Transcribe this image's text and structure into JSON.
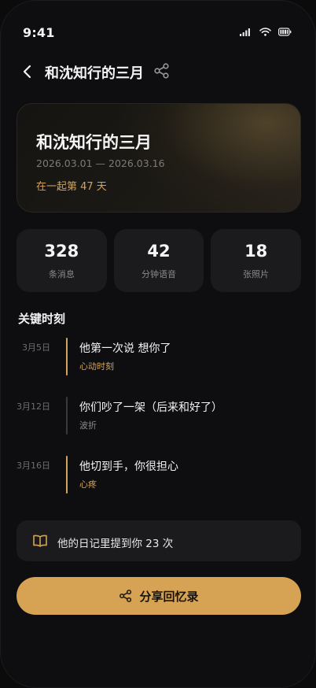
{
  "status_bar": {
    "time": "9:41",
    "icons": [
      "signal-icon",
      "wifi-icon",
      "battery-icon"
    ]
  },
  "header": {
    "back_icon": "chevron-left-icon",
    "title": "和沈知行的三月",
    "share_icon": "share-icon"
  },
  "hero": {
    "title": "和沈知行的三月",
    "dates": "2026.03.01 — 2026.03.16",
    "together": "在一起第 47 天"
  },
  "stats": [
    {
      "value": "328",
      "label": "条消息"
    },
    {
      "value": "42",
      "label": "分钟语音"
    },
    {
      "value": "18",
      "label": "张照片"
    }
  ],
  "moments": {
    "title": "关键时刻",
    "items": [
      {
        "date": "3月5日",
        "title": "他第一次说 想你了",
        "tag": "心动时刻",
        "accent": "#d3a35a",
        "tag_color": "#d3a35a"
      },
      {
        "date": "3月12日",
        "title": "你们吵了一架（后来和好了）",
        "tag": "波折",
        "accent": "#3a3a3e",
        "tag_color": "#8a8a8e"
      },
      {
        "date": "3月16日",
        "title": "他切到手，你很担心",
        "tag": "心疼",
        "accent": "#d3a35a",
        "tag_color": "#d3a35a"
      }
    ]
  },
  "diary": {
    "icon": "book-open-icon",
    "text": "他的日记里提到你 23 次"
  },
  "share_button": {
    "icon": "share-icon",
    "label": "分享回忆录"
  },
  "colors": {
    "background": "#0e0e10",
    "card": "#1b1b1e",
    "accent": "#d6a254",
    "accent_text": "#d3a35a",
    "muted": "#8a8a8e"
  }
}
